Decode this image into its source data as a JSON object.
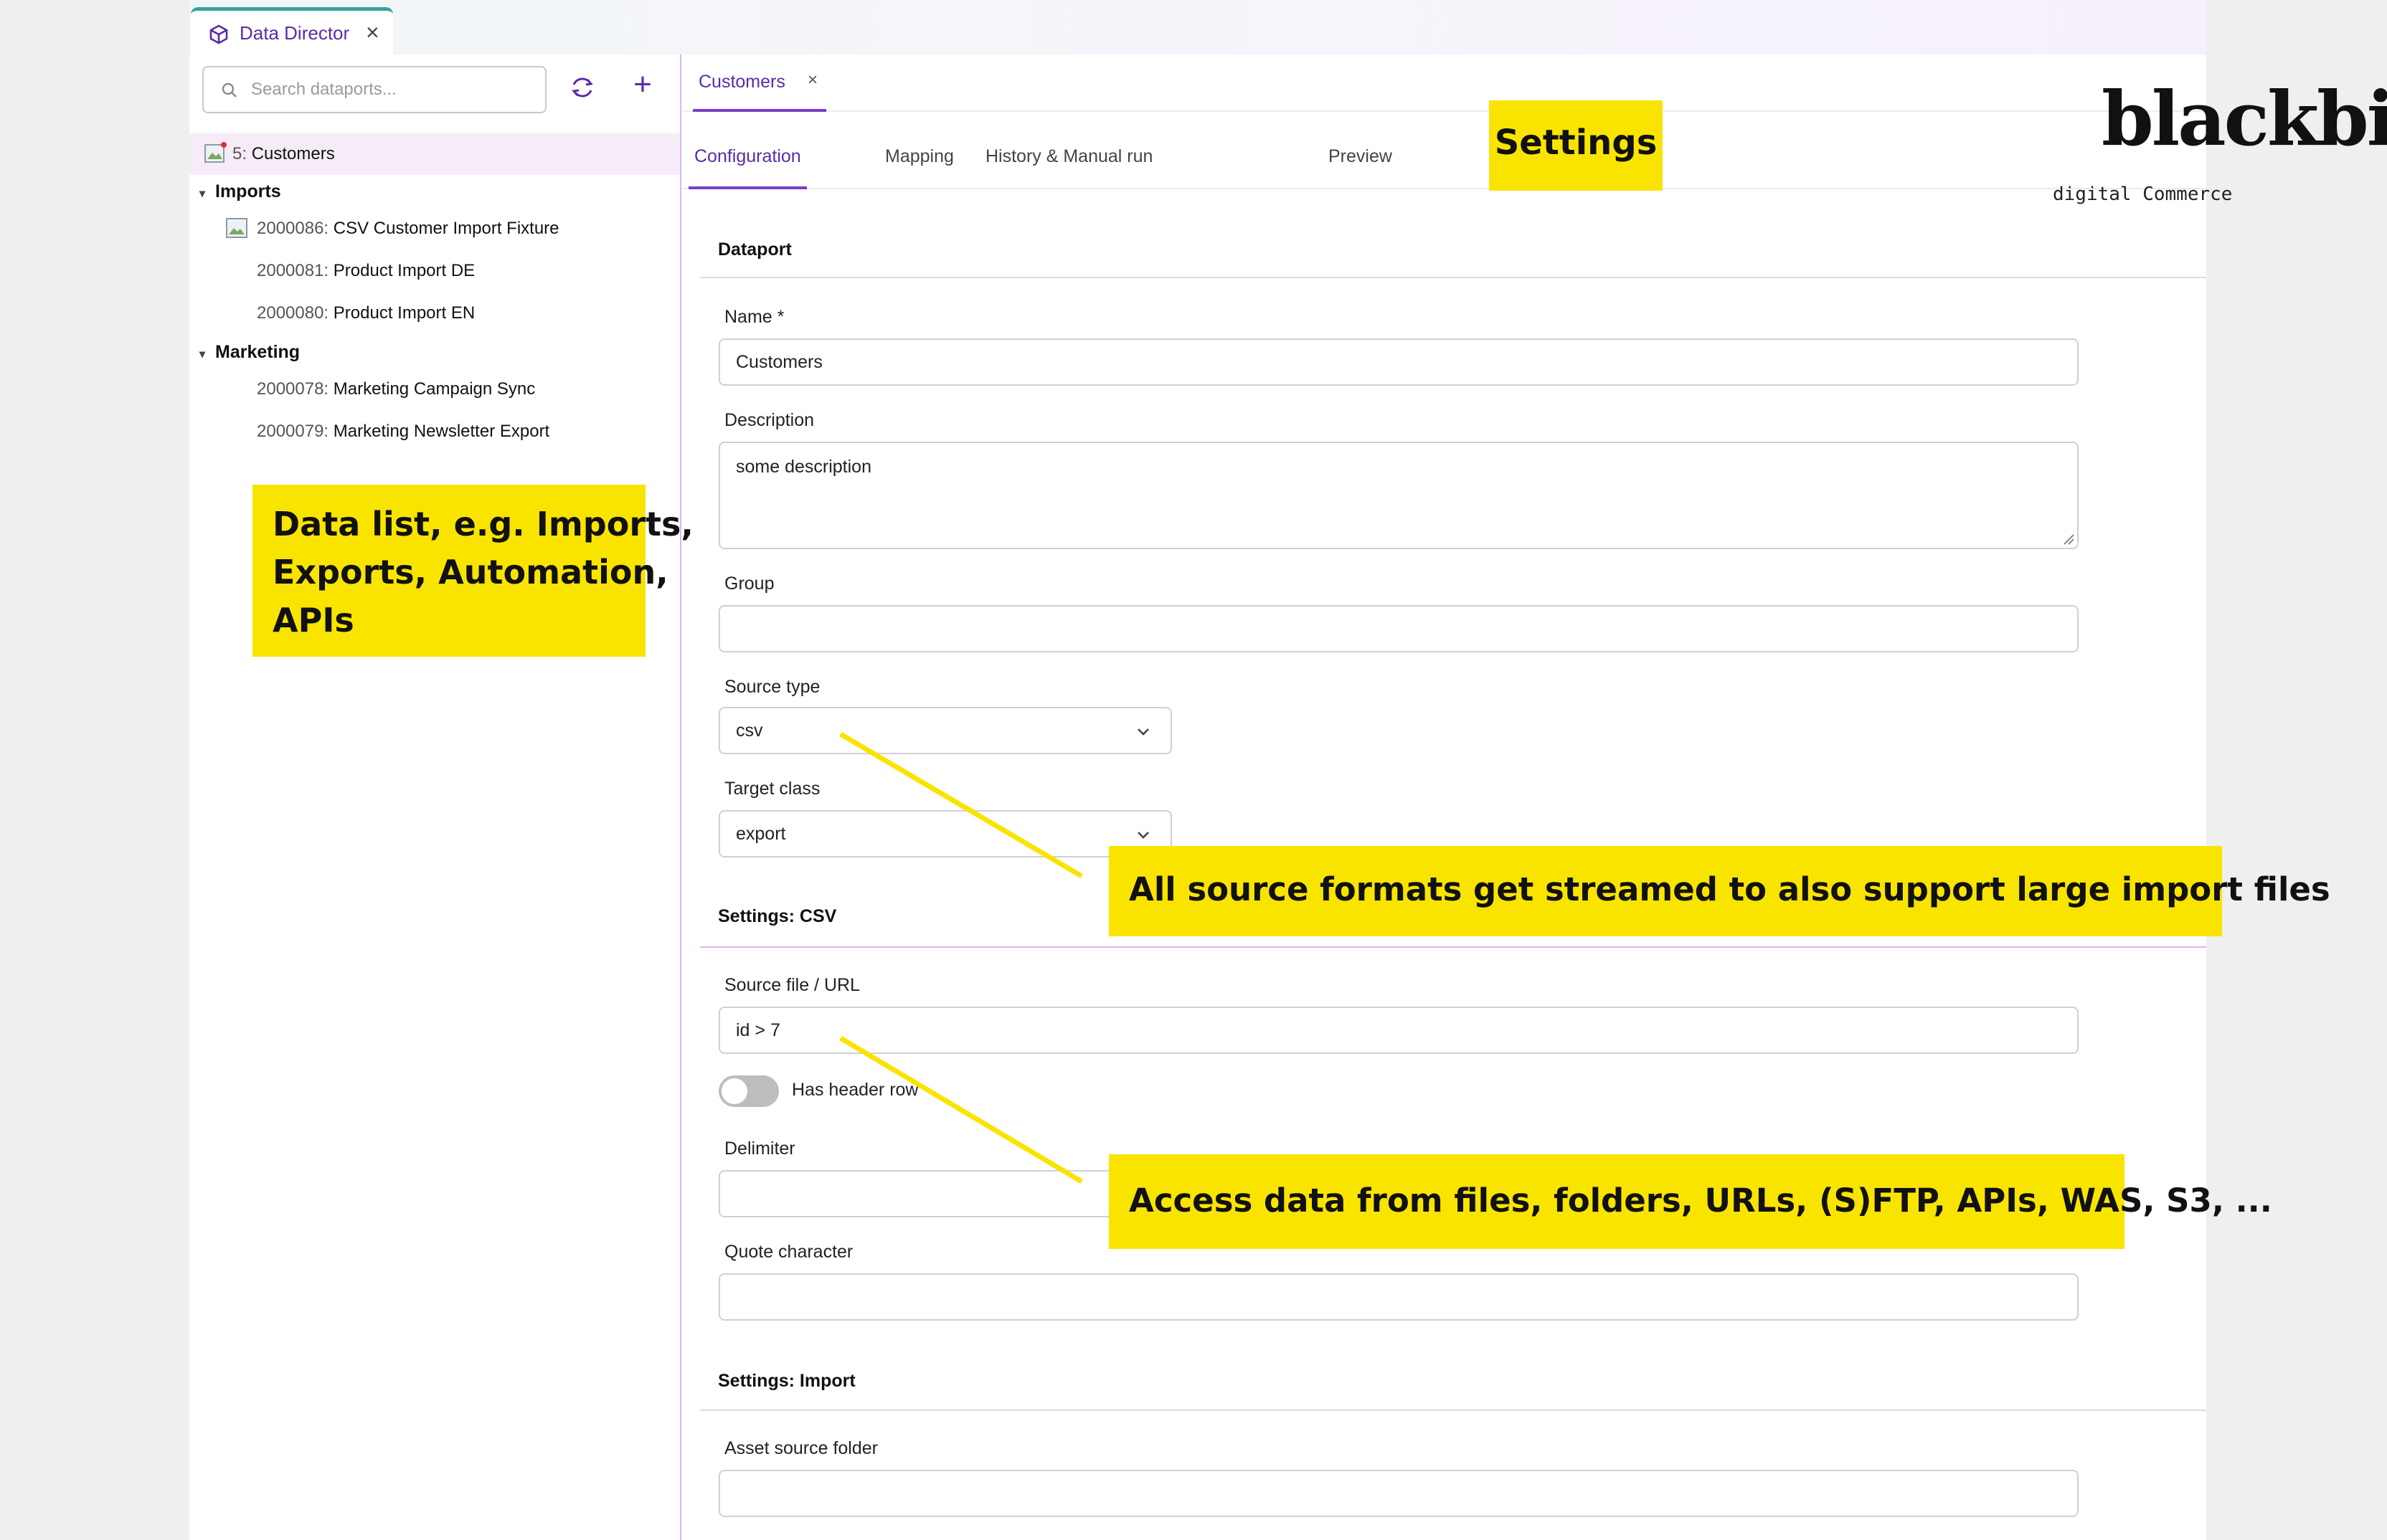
{
  "app_tab": {
    "label": "Data Director"
  },
  "sidebar": {
    "search_placeholder": "Search dataports...",
    "selected": {
      "id": "5:",
      "name": "Customers"
    },
    "folders": [
      {
        "name": "Imports",
        "items": [
          {
            "id": "2000086:",
            "name": "CSV Customer Import Fixture"
          },
          {
            "id": "2000081:",
            "name": "Product Import DE"
          },
          {
            "id": "2000080:",
            "name": "Product Import EN"
          }
        ]
      },
      {
        "name": "Marketing",
        "items": [
          {
            "id": "2000078:",
            "name": "Marketing Campaign Sync"
          },
          {
            "id": "2000079:",
            "name": "Marketing Newsletter Export"
          }
        ]
      }
    ]
  },
  "doc_tab": {
    "label": "Customers"
  },
  "subtabs": [
    "Configuration",
    "Mapping",
    "History & Manual run",
    "Preview"
  ],
  "form": {
    "dataport_title": "Dataport",
    "name_label": "Name *",
    "name_value": "Customers",
    "description_label": "Description",
    "description_value": "some description",
    "group_label": "Group",
    "group_value": "",
    "source_type_label": "Source type",
    "source_type_value": "csv",
    "target_class_label": "Target class",
    "target_class_value": "export",
    "csv_title": "Settings: CSV",
    "source_file_label": "Source file / URL",
    "source_file_value": "id > 7",
    "header_row_label": "Has header row",
    "header_row_on": false,
    "delimiter_label": "Delimiter",
    "delimiter_value": "",
    "quote_label": "Quote character",
    "quote_value": "",
    "import_title": "Settings: Import",
    "asset_folder_label": "Asset source folder",
    "asset_folder_value": ""
  },
  "brand": {
    "logo": "blackbit",
    "tagline": "digital Commerce"
  },
  "callouts": {
    "settings": "Settings",
    "data_list": [
      "Data list, e.g. Imports,",
      "Exports, Automation,",
      "APIs"
    ],
    "streaming": "All source formats get streamed to also support large import files",
    "access": "Access data from files, folders, URLs, (S)FTP, APIs, WAS, S3, ..."
  },
  "colors": {
    "accent": "#5a2ba8",
    "callout": "#f9e400",
    "teal": "#3ba0a0"
  }
}
